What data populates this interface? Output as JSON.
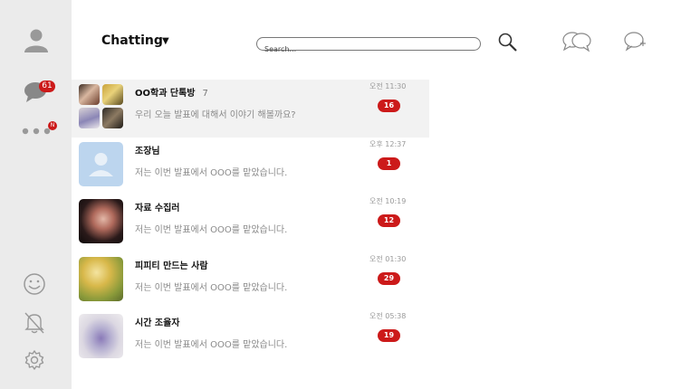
{
  "sidebar": {
    "chat_badge": "61",
    "more_badge": "N"
  },
  "header": {
    "title": "Chatting",
    "caret": "▼",
    "search_placeholder": "Search..."
  },
  "chats": [
    {
      "name": "OO학과 단톡방",
      "member_count": "7",
      "message": "우리 오늘 발표에 대해서 이야기 해볼까요?",
      "time": "오전 11:30",
      "unread": "16"
    },
    {
      "name": "조장님",
      "member_count": "",
      "message": "저는 이번 발표에서 OOO를 맡았습니다.",
      "time": "오후 12:37",
      "unread": "1"
    },
    {
      "name": "자료 수집러",
      "member_count": "",
      "message": "저는 이번 발표에서 OOO를 맡았습니다.",
      "time": "오전 10:19",
      "unread": "12"
    },
    {
      "name": "피피티 만드는 사람",
      "member_count": "",
      "message": "저는 이번 발표에서 OOO를 맡았습니다.",
      "time": "오전 01:30",
      "unread": "29"
    },
    {
      "name": "시간 조율자",
      "member_count": "",
      "message": "저는 이번 발표에서 OOO를 맡았습니다.",
      "time": "오전 05:38",
      "unread": "19"
    }
  ],
  "colors": {
    "badge": "#cc1a1a",
    "sidebar_bg": "#ebebeb",
    "active_row": "#f2f2f2"
  },
  "icons": [
    "profile-icon",
    "chat-bubble-icon",
    "more-icon",
    "emoji-icon",
    "notification-off-icon",
    "settings-icon",
    "search-icon",
    "open-chats-icon",
    "new-chat-icon"
  ]
}
